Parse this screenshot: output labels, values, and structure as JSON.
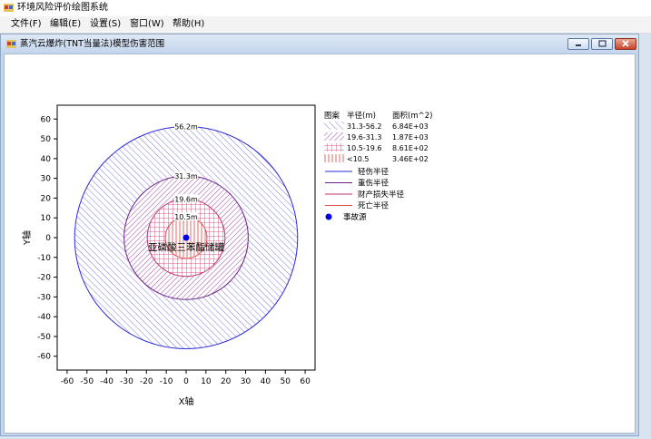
{
  "app": {
    "title": "环境风险评价绘图系统",
    "menu": [
      "文件(F)",
      "编辑(E)",
      "设置(S)",
      "窗口(W)",
      "帮助(H)"
    ]
  },
  "window": {
    "title": "蒸汽云爆炸(TNT当量法)模型伤害范围"
  },
  "chart_data": {
    "type": "other",
    "subtype": "concentric hazard zones",
    "xlabel": "X轴",
    "ylabel": "Y轴",
    "xlim": [
      -65,
      65
    ],
    "ylim": [
      -67,
      67
    ],
    "xticks": [
      -60,
      -50,
      -40,
      -30,
      -20,
      -10,
      0,
      10,
      20,
      30,
      40,
      50,
      60
    ],
    "yticks": [
      60,
      50,
      40,
      30,
      20,
      10,
      0,
      -10,
      -20,
      -30,
      -40,
      -50,
      -60
    ],
    "grid": false,
    "legend_position": "right",
    "center": {
      "x": 0,
      "y": 0
    },
    "source_name": "亚磷酸三苯酯储罐",
    "rings": [
      {
        "radius": 56.2,
        "label": "56.2m",
        "color": "#2b2bd9",
        "name": "轻伤半径"
      },
      {
        "radius": 31.3,
        "label": "31.3m",
        "color": "#6a1e8a",
        "name": "重伤半径"
      },
      {
        "radius": 19.6,
        "label": "19.6m",
        "color": "#c0306f",
        "name": "财产损失半径"
      },
      {
        "radius": 10.5,
        "label": "10.5m",
        "color": "#e24a4a",
        "name": "死亡半径"
      }
    ],
    "zone_table": {
      "headers": [
        "图案",
        "半径(m)",
        "面积(m^2)"
      ],
      "rows": [
        {
          "range": "31.3-56.2",
          "area": "6.84E+03",
          "pattern": "diag",
          "color": "#7b7bd8"
        },
        {
          "range": "19.6-31.3",
          "area": "1.87E+03",
          "pattern": "backdiag",
          "color": "#9a4aa6"
        },
        {
          "range": "10.5-19.6",
          "area": "8.61E+02",
          "pattern": "cross",
          "color": "#d0306a"
        },
        {
          "range": "<10.5",
          "area": "3.46E+02",
          "pattern": "vertical",
          "color": "#e86a6a"
        }
      ]
    },
    "line_legend": [
      {
        "label": "轻伤半径",
        "color": "#2b2bd9"
      },
      {
        "label": "重伤半径",
        "color": "#6a1e8a"
      },
      {
        "label": "财产损失半径",
        "color": "#c0306f"
      },
      {
        "label": "死亡半径",
        "color": "#e24a4a"
      }
    ],
    "marker_legend": {
      "label": "事故源",
      "color": "#0000ee"
    }
  }
}
